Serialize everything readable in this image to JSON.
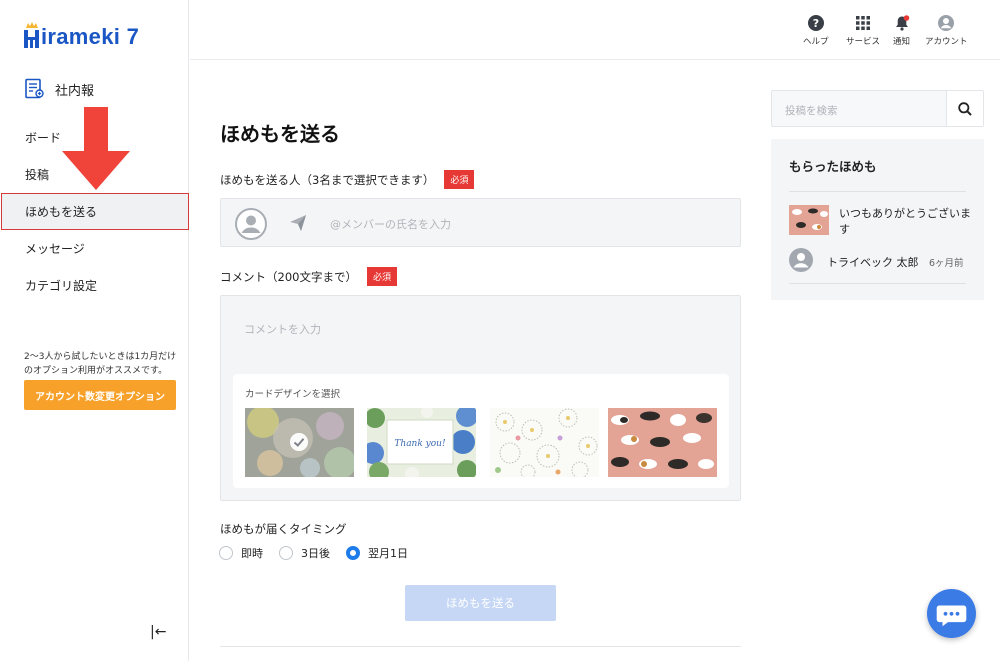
{
  "sidebar": {
    "logo_text": "irameki 7",
    "section_title": "社内報",
    "nav": [
      {
        "label": "ボード"
      },
      {
        "label": "投稿"
      },
      {
        "label": "ほめもを送る"
      },
      {
        "label": "メッセージ"
      },
      {
        "label": "カテゴリ設定"
      }
    ],
    "promo_text": "2〜3人から試したいときは1カ月だけのオプション利用がオススメです。",
    "promo_button": "アカウント数変更オプション",
    "collapse_icon": "|←"
  },
  "header": {
    "buttons": [
      {
        "label": "ヘルプ",
        "icon": "help-icon"
      },
      {
        "label": "サービス",
        "icon": "grid-icon"
      },
      {
        "label": "通知",
        "icon": "bell-icon"
      },
      {
        "label": "アカウント",
        "icon": "account-icon"
      }
    ]
  },
  "main": {
    "title": "ほめもを送る",
    "recipient_label": "ほめもを送る人（3名まで選択できます）",
    "required": "必須",
    "recipient_placeholder": "@メンバーの氏名を入力",
    "comment_label": "コメント（200文字まで）",
    "comment_placeholder": "コメントを入力",
    "card_select_label": "カードデザインを選択",
    "cards": [
      {
        "name": "bubbles",
        "selected": true
      },
      {
        "name": "thank-you-flowers",
        "selected": false,
        "text": "Thank you!"
      },
      {
        "name": "white-flowers",
        "selected": false
      },
      {
        "name": "cats",
        "selected": false
      }
    ],
    "timing_label": "ほめもが届くタイミング",
    "timing_options": [
      {
        "label": "即時",
        "selected": false
      },
      {
        "label": "3日後",
        "selected": false
      },
      {
        "label": "翌月1日",
        "selected": true
      }
    ],
    "submit": "ほめもを送る"
  },
  "right": {
    "search_placeholder": "投稿を検索",
    "received_title": "もらったほめも",
    "received": [
      {
        "message": "いつもありがとうございます",
        "sender": "トライベック 太郎",
        "time": "6ヶ月前"
      }
    ]
  },
  "colors": {
    "brand": "#1a56c4",
    "accent_orange": "#f7a12a",
    "required_red": "#e63935",
    "radio_blue": "#1e7bea",
    "button_disabled": "#c6d7f5",
    "arrow_red": "#f0443b"
  }
}
